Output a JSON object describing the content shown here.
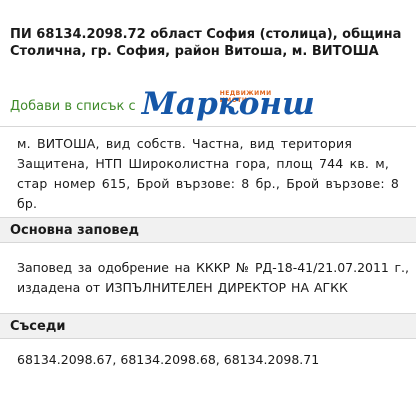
{
  "property": {
    "title": "ПИ 68134.2098.72 област София (столица), община Столична, гр. София, район Витоша, м. ВИТОША",
    "add_to_list_label": "Добави в списък с",
    "logo": {
      "name": "Марконш",
      "subtitle": "НЕДВИЖИМИ ИМОТИ"
    },
    "description": "м. ВИТОША, вид собств. Частна, вид територия Защитена, НТП Широколистна гора, площ 744 кв. м, стар номер 615, Брой вързове: 8 бр., Брой вързове: 8 бр."
  },
  "main_order": {
    "heading": "Основна заповед",
    "text": "Заповед за одобрение на КККР № РД-18-41/21.07.2011 г., издадена от ИЗПЪЛНИТЕЛЕН ДИРЕКТОР НА АГКК"
  },
  "neighbors": {
    "heading": "Съседи",
    "text": "68134.2098.67, 68134.2098.68, 68134.2098.71"
  },
  "colors": {
    "link_green": "#3f8a2a",
    "logo_blue": "#1557a8",
    "logo_orange": "#e0641b",
    "header_bg": "#f1f1f1"
  }
}
